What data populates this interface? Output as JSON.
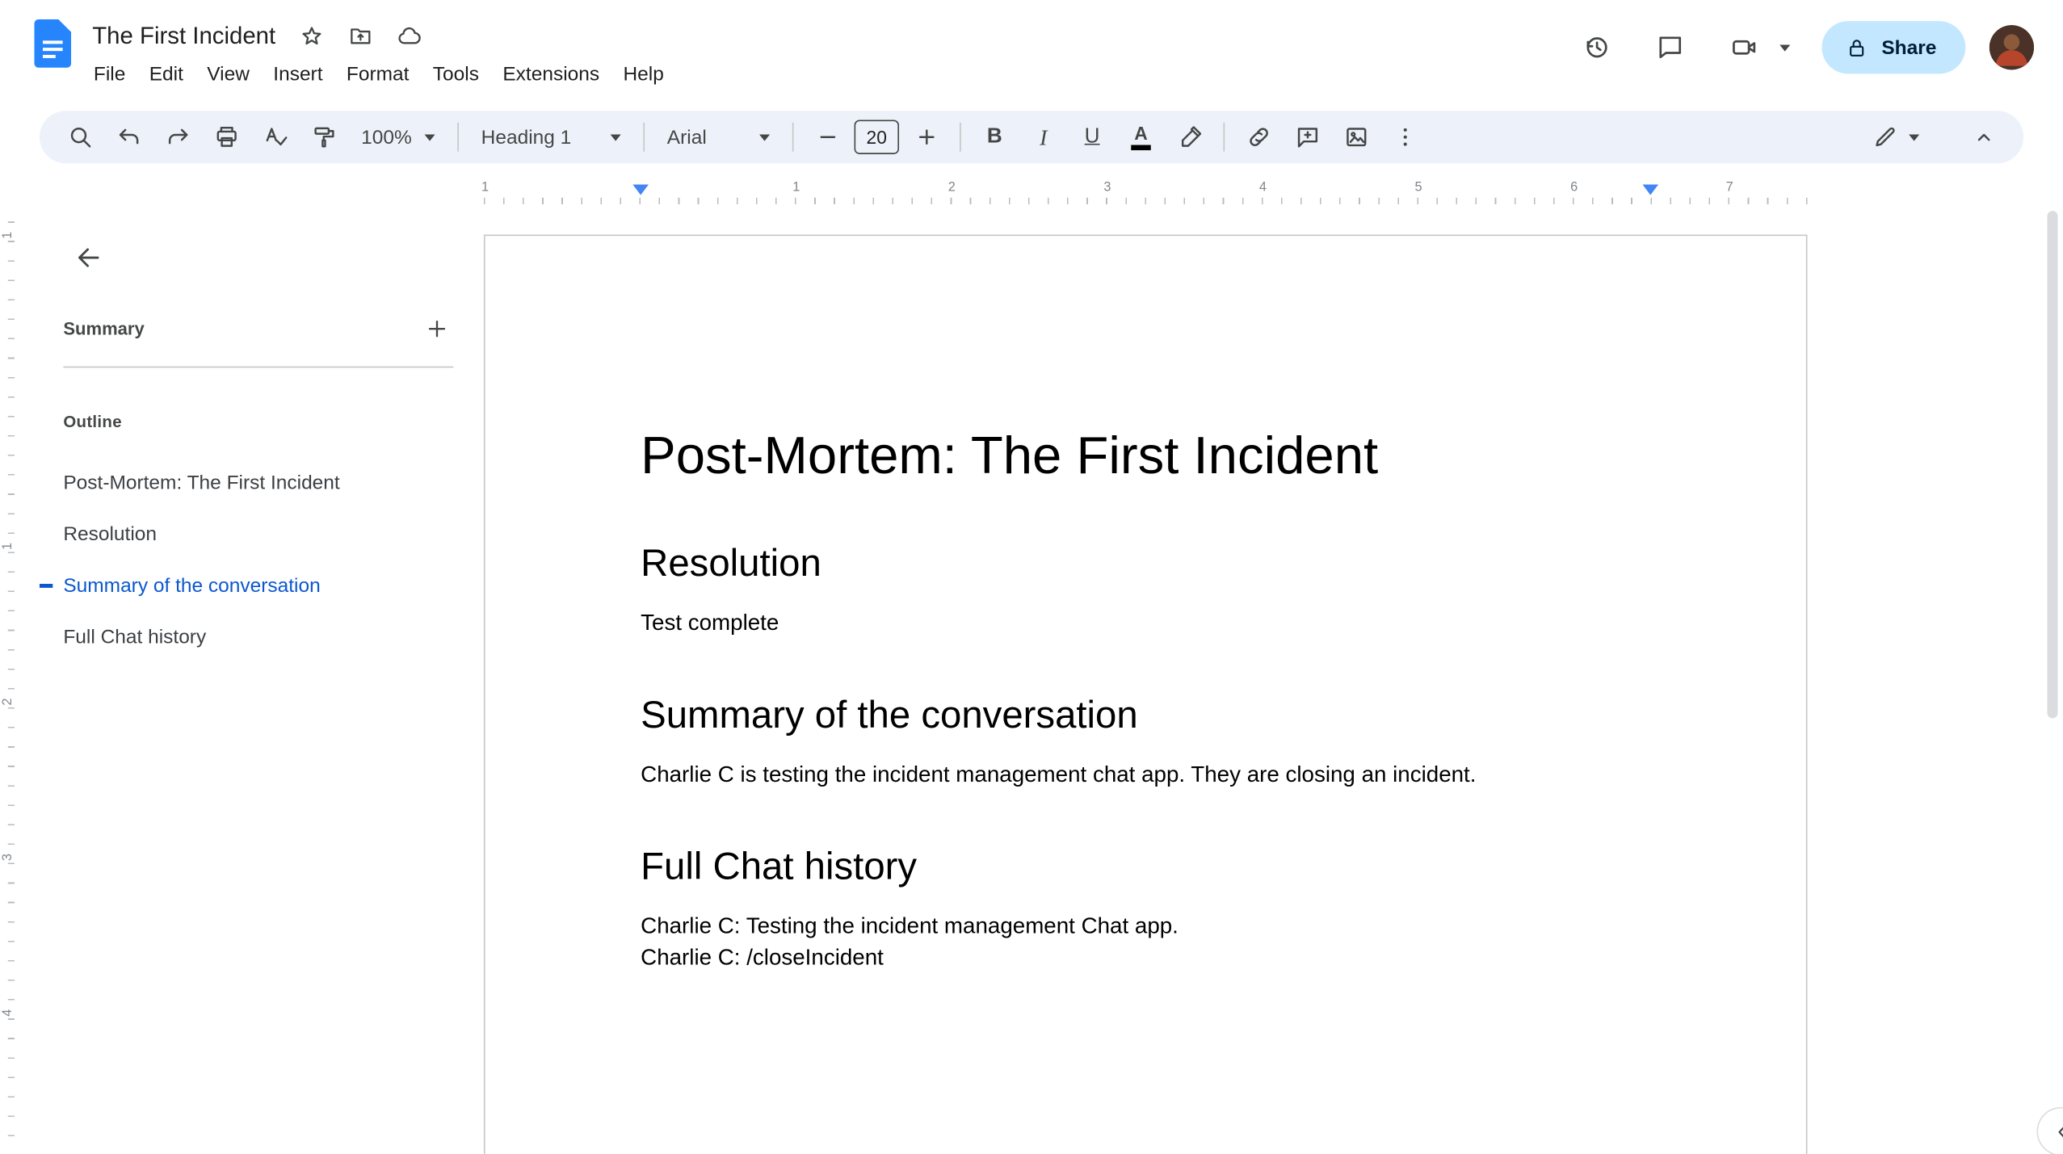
{
  "header": {
    "doc_title": "The First Incident",
    "menus": [
      "File",
      "Edit",
      "View",
      "Insert",
      "Format",
      "Tools",
      "Extensions",
      "Help"
    ],
    "share_label": "Share"
  },
  "toolbar": {
    "zoom_value": "100%",
    "style_value": "Heading 1",
    "font_value": "Arial",
    "font_size_value": "20",
    "bold_label": "B",
    "italic_label": "I",
    "underline_label": "U",
    "text_color_label": "A"
  },
  "ruler": {
    "h_numbers": [
      "1",
      "1",
      "2",
      "3",
      "4",
      "5",
      "6",
      "7"
    ],
    "v_numbers": [
      "1",
      "1",
      "2",
      "3",
      "4"
    ]
  },
  "sidebar": {
    "summary_label": "Summary",
    "outline_label": "Outline",
    "items": [
      {
        "label": "Post-Mortem: The First Incident",
        "active": false
      },
      {
        "label": "Resolution",
        "active": false
      },
      {
        "label": "Summary of the conversation",
        "active": true
      },
      {
        "label": "Full Chat history",
        "active": false
      }
    ]
  },
  "doc": {
    "title": "Post-Mortem: The First Incident",
    "sections": [
      {
        "heading": "Resolution",
        "paragraphs": [
          "Test complete"
        ]
      },
      {
        "heading": "Summary of the conversation",
        "paragraphs": [
          "Charlie C is testing the incident management chat app. They are closing an incident."
        ]
      },
      {
        "heading": "Full Chat history",
        "paragraphs": [
          "Charlie C: Testing the incident management Chat app.",
          "Charlie C: /closeIncident"
        ]
      }
    ]
  },
  "colors": {
    "accent_blue": "#0b57d0",
    "share_bg": "#c2e7ff",
    "share_text": "#001d35",
    "toolbar_bg": "#edf2fa",
    "icon_gray": "#444746",
    "docs_logo_blue": "#2684fc",
    "ruler_marker_blue": "#4285f4"
  }
}
